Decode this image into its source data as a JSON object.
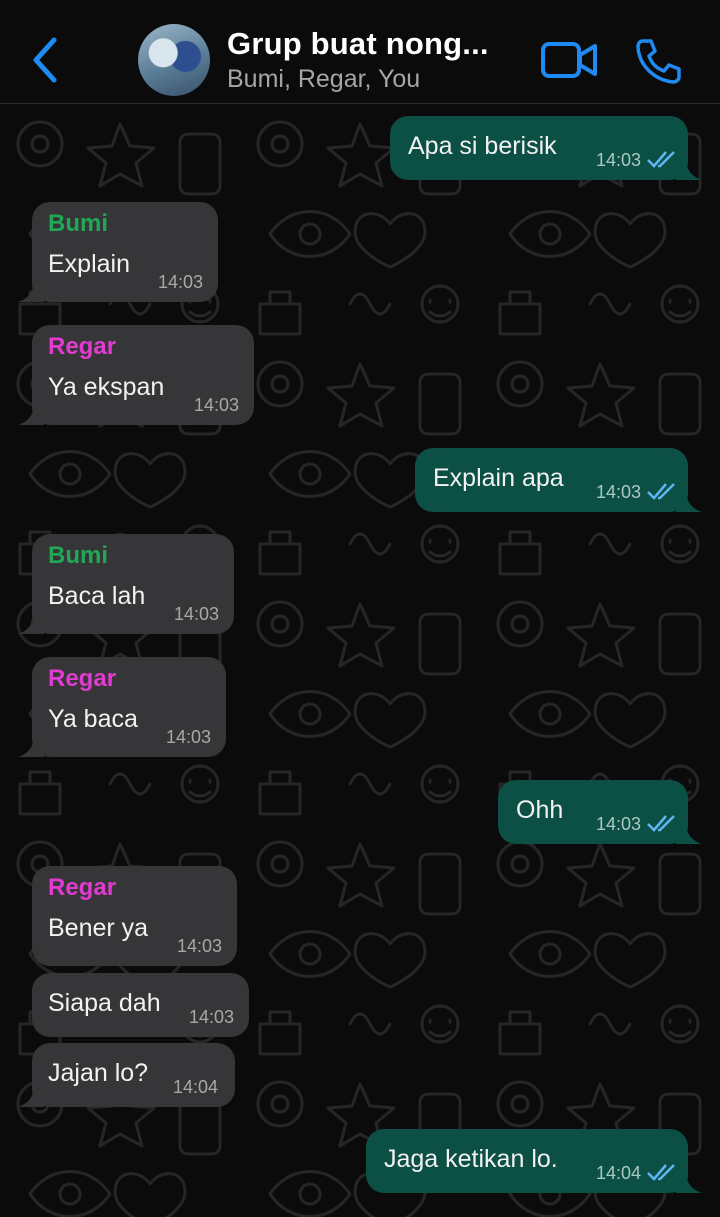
{
  "colors": {
    "accent": "#1f8bf2",
    "incoming_bubble": "#363638",
    "outgoing_bubble": "#0b4f45",
    "bumi": "#1fa855",
    "regar": "#e13bd1",
    "read_ticks": "#5fb6f0"
  },
  "header": {
    "title": "Grup buat nong...",
    "subtitle": "Bumi, Regar, You",
    "back_icon": "chevron-left-icon",
    "video_icon": "video-camera-icon",
    "call_icon": "phone-icon"
  },
  "messages": [
    {
      "direction": "out",
      "text": "Apa si berisik",
      "time": "14:03",
      "status": "read"
    },
    {
      "direction": "in",
      "sender": "Bumi",
      "text": "Explain",
      "time": "14:03"
    },
    {
      "direction": "in",
      "sender": "Regar",
      "text": "Ya ekspan",
      "time": "14:03"
    },
    {
      "direction": "out",
      "text": "Explain apa",
      "time": "14:03",
      "status": "read"
    },
    {
      "direction": "in",
      "sender": "Bumi",
      "text": "Baca lah",
      "time": "14:03"
    },
    {
      "direction": "in",
      "sender": "Regar",
      "text": "Ya baca",
      "time": "14:03"
    },
    {
      "direction": "out",
      "text": "Ohh",
      "time": "14:03",
      "status": "read"
    },
    {
      "direction": "in",
      "sender": "Regar",
      "text": "Bener ya",
      "time": "14:03"
    },
    {
      "direction": "in",
      "text": "Siapa dah",
      "time": "14:03"
    },
    {
      "direction": "in",
      "text": "Jajan lo?",
      "time": "14:04"
    },
    {
      "direction": "out",
      "text": "Jaga ketikan lo.",
      "time": "14:04",
      "status": "read"
    }
  ]
}
